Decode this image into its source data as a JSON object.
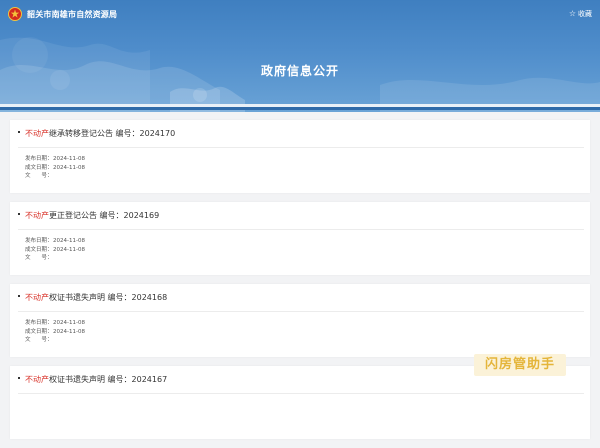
{
  "header": {
    "site_title": "韶关市南雄市自然资源局",
    "favorite_label": "收藏",
    "page_title": "政府信息公开"
  },
  "colors": {
    "banner": "#4f8dcb",
    "tag": "#d9342b",
    "watermark": "#e4b53a"
  },
  "items": [
    {
      "tag": "不动产",
      "title": "继承转移登记公告 编号：2024170",
      "publish_label": "发布日期：",
      "publish_date": "2024-11-08",
      "create_label": "成文日期：",
      "create_date": "2024-11-08",
      "doc_label": "文　　号：",
      "doc_no": ""
    },
    {
      "tag": "不动产",
      "title": "更正登记公告 编号：2024169",
      "publish_label": "发布日期：",
      "publish_date": "2024-11-08",
      "create_label": "成文日期：",
      "create_date": "2024-11-08",
      "doc_label": "文　　号：",
      "doc_no": ""
    },
    {
      "tag": "不动产",
      "title": "权证书遗失声明 编号：2024168",
      "publish_label": "发布日期：",
      "publish_date": "2024-11-08",
      "create_label": "成文日期：",
      "create_date": "2024-11-08",
      "doc_label": "文　　号：",
      "doc_no": ""
    },
    {
      "tag": "不动产",
      "title": "权证书遗失声明 编号：2024167"
    }
  ],
  "watermark": "闪房管助手"
}
